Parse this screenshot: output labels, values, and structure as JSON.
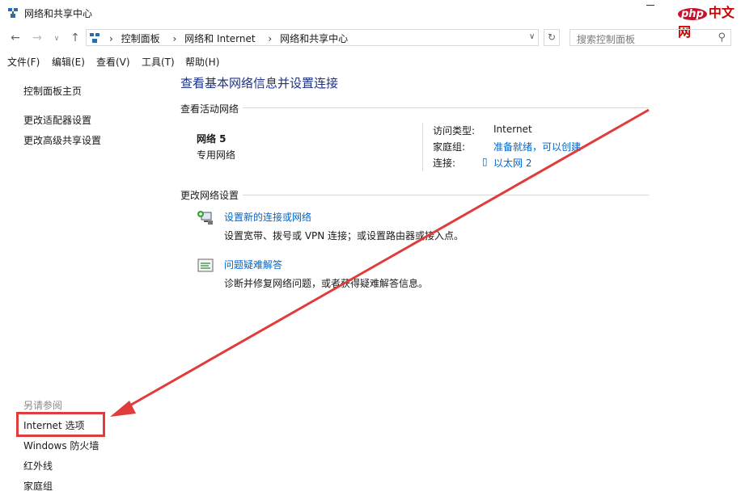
{
  "window": {
    "title": "网络和共享中心"
  },
  "watermark": {
    "logo": "php",
    "text": "中文网"
  },
  "nav": {
    "back": "←",
    "forward": "→",
    "recent": "∨",
    "up": "↑",
    "breadcrumb": [
      "控制面板",
      "网络和 Internet",
      "网络和共享中心"
    ],
    "refresh": "↻",
    "search_placeholder": "搜索控制面板"
  },
  "menu": [
    "文件(F)",
    "编辑(E)",
    "查看(V)",
    "工具(T)",
    "帮助(H)"
  ],
  "sidebar": {
    "home": "控制面板主页",
    "items": [
      "更改适配器设置",
      "更改高级共享设置"
    ],
    "see_also_title": "另请参阅",
    "see_also": [
      "Internet 选项",
      "Windows 防火墙",
      "红外线",
      "家庭组"
    ]
  },
  "main": {
    "title": "查看基本网络信息并设置连接",
    "active_networks": {
      "header": "查看活动网络",
      "name": "网络  5",
      "type": "专用网络",
      "access_label": "访问类型:",
      "access_value": "Internet",
      "homegroup_label": "家庭组:",
      "homegroup_value": "准备就绪，可以创建",
      "connections_label": "连接:",
      "connections_value": "以太网 2"
    },
    "change_settings": {
      "header": "更改网络设置",
      "items": [
        {
          "link": "设置新的连接或网络",
          "desc": "设置宽带、拨号或 VPN 连接；或设置路由器或接入点。",
          "icon": "network-setup-icon"
        },
        {
          "link": "问题疑难解答",
          "desc": "诊断并修复网络问题，或者获得疑难解答信息。",
          "icon": "troubleshoot-icon"
        }
      ]
    }
  },
  "colors": {
    "link": "#0066cc",
    "title": "#1e3287",
    "annotation": "#e03c3c"
  }
}
